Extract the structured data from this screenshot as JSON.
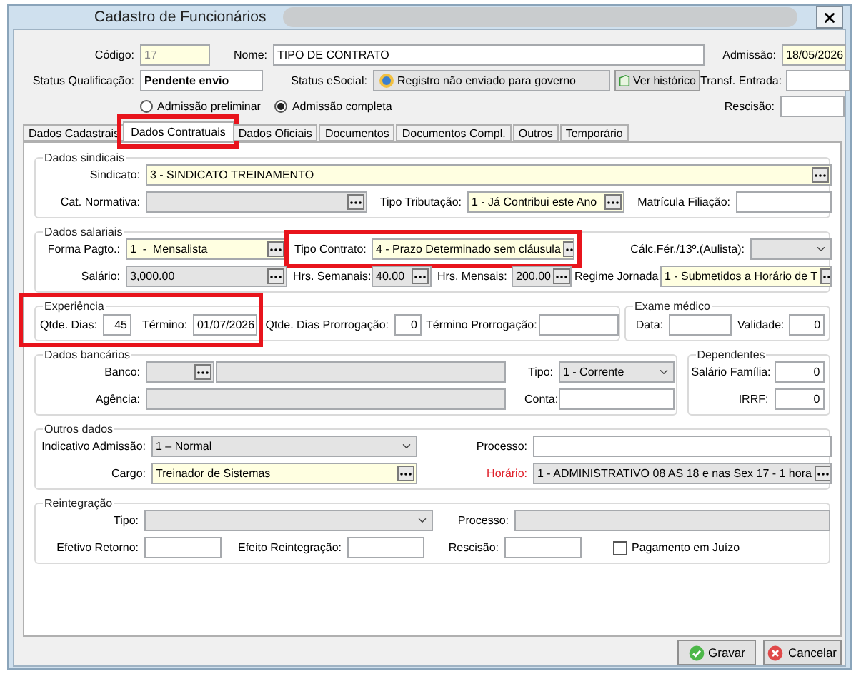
{
  "window": {
    "title": "Cadastro de Funcionários"
  },
  "header": {
    "codigo": {
      "label": "Código:",
      "value": "17",
      "mandatory": true,
      "read_only": true
    },
    "nome": {
      "label": "Nome:",
      "value": "TIPO DE CONTRATO"
    },
    "admissao": {
      "label": "Admissão:",
      "value": "18/05/2026",
      "mandatory": true
    },
    "status_qualificacao": {
      "label": "Status Qualificação:",
      "value": "Pendente envio",
      "read_only": false
    },
    "status_esocial": {
      "label": "Status eSocial:",
      "value": "Registro não enviado para governo"
    },
    "ver_historico": {
      "label": "Ver histórico"
    },
    "transf_entrada": {
      "label": "Transf. Entrada:"
    },
    "rescisao": {
      "label": "Rescisão:"
    },
    "admission_type": [
      {
        "label": "Admissão preliminar",
        "selected": false
      },
      {
        "label": "Admissão completa",
        "selected": true
      }
    ]
  },
  "tabs": [
    {
      "label": "Dados Cadastrais",
      "selected": false,
      "highlighted": false
    },
    {
      "label": "Dados Contratuais",
      "selected": true,
      "highlighted": true
    },
    {
      "label": "Dados Oficiais",
      "selected": false,
      "highlighted": false
    },
    {
      "label": "Documentos",
      "selected": false,
      "highlighted": false
    },
    {
      "label": "Documentos Compl.",
      "selected": false,
      "highlighted": false
    },
    {
      "label": "Outros",
      "selected": false,
      "highlighted": false
    },
    {
      "label": "Temporário",
      "selected": false,
      "highlighted": false
    }
  ],
  "dados_sindicais": {
    "title": "Dados sindicais",
    "sindicato": {
      "label": "Sindicato:",
      "value": "3 - SINDICATO TREINAMENTO",
      "kind": "lookup",
      "mandatory": true
    },
    "cat_normativa": {
      "label": "Cat. Normativa:",
      "kind": "lookup",
      "disabled": true
    },
    "tipo_tributacao": {
      "label": "Tipo Tributação:",
      "value": "1 - Já Contribui este Ano",
      "kind": "lookup",
      "mandatory": true
    },
    "matricula_filiacao": {
      "label": "Matrícula Filiação:"
    }
  },
  "dados_salariais": {
    "title": "Dados salariais",
    "forma_pagto": {
      "label": "Forma Pagto.:",
      "value": "1  -  Mensalista",
      "kind": "lookup",
      "mandatory": true
    },
    "tipo_contrato": {
      "label": "Tipo Contrato:",
      "value": "4 - Prazo Determinado sem cláusula",
      "kind": "lookup",
      "mandatory": true,
      "highlighted": true
    },
    "calc_ferias": {
      "label": "Cálc.Fér./13º.(Aulista):",
      "kind": "select",
      "disabled": true
    },
    "salario": {
      "label": "Salário:",
      "value": "3,000.00",
      "kind": "lookup",
      "disabled": true
    },
    "hrs_semanais": {
      "label": "Hrs. Semanais:",
      "value": "40.00",
      "kind": "lookup",
      "disabled": true
    },
    "hrs_mensais": {
      "label": "Hrs. Mensais:",
      "value": "200.00",
      "kind": "lookup",
      "disabled": true
    },
    "regime_jornada": {
      "label": "Regime Jornada:",
      "value": "1 - Submetidos a Horário de T",
      "kind": "lookup",
      "mandatory": true
    }
  },
  "experiencia": {
    "title": "Experiência",
    "highlighted": true,
    "qtde_dias": {
      "label": "Qtde. Dias:",
      "value": "45"
    },
    "termino": {
      "label": "Término:",
      "value": "01/07/2026"
    },
    "qtde_dias_prorrogacao": {
      "label": "Qtde. Dias Prorrogação:",
      "value": "0"
    },
    "termino_prorrogacao": {
      "label": "Término Prorrogação:"
    }
  },
  "exame_medico": {
    "title": "Exame médico",
    "data": {
      "label": "Data:"
    },
    "validade": {
      "label": "Validade:",
      "value": "0"
    }
  },
  "dados_bancarios": {
    "title": "Dados bancários",
    "banco": {
      "label": "Banco:",
      "kind": "lookup",
      "disabled": true
    },
    "tipo": {
      "label": "Tipo:",
      "value": "1 - Corrente",
      "kind": "select",
      "disabled": true
    },
    "agencia": {
      "label": "Agência:",
      "disabled": true
    },
    "conta": {
      "label": "Conta:"
    }
  },
  "dependentes": {
    "title": "Dependentes",
    "salario_familia": {
      "label": "Salário Família:",
      "value": "0"
    },
    "irrf": {
      "label": "IRRF:",
      "value": "0"
    }
  },
  "outros_dados": {
    "title": "Outros dados",
    "indicativo_admissao": {
      "label": "Indicativo Admissão:",
      "value": "1 – Normal",
      "kind": "select",
      "disabled": true
    },
    "processo": {
      "label": "Processo:"
    },
    "cargo": {
      "label": "Cargo:",
      "value": "Treinador de Sistemas",
      "kind": "lookup",
      "mandatory": true
    },
    "horario": {
      "label": "Horário:",
      "value": "1 - ADMINISTRATIVO 08 AS 18 e nas Sex 17 - 1 hora",
      "kind": "lookup",
      "disabled": true,
      "alert": true
    }
  },
  "reintegracao": {
    "title": "Reintegração",
    "tipo": {
      "label": "Tipo:",
      "kind": "select",
      "disabled": true
    },
    "processo": {
      "label": "Processo:",
      "disabled": true
    },
    "efetivo_retorno": {
      "label": "Efetivo Retorno:"
    },
    "efeito_reintegracao": {
      "label": "Efeito Reintegração:"
    },
    "rescisao": {
      "label": "Rescisão:"
    },
    "pagamento_em_juizo": {
      "label": "Pagamento em Juízo",
      "checked": false
    }
  },
  "buttons": [
    {
      "label": "Gravar",
      "kind": "save"
    },
    {
      "label": "Cancelar",
      "kind": "cancel"
    }
  ]
}
